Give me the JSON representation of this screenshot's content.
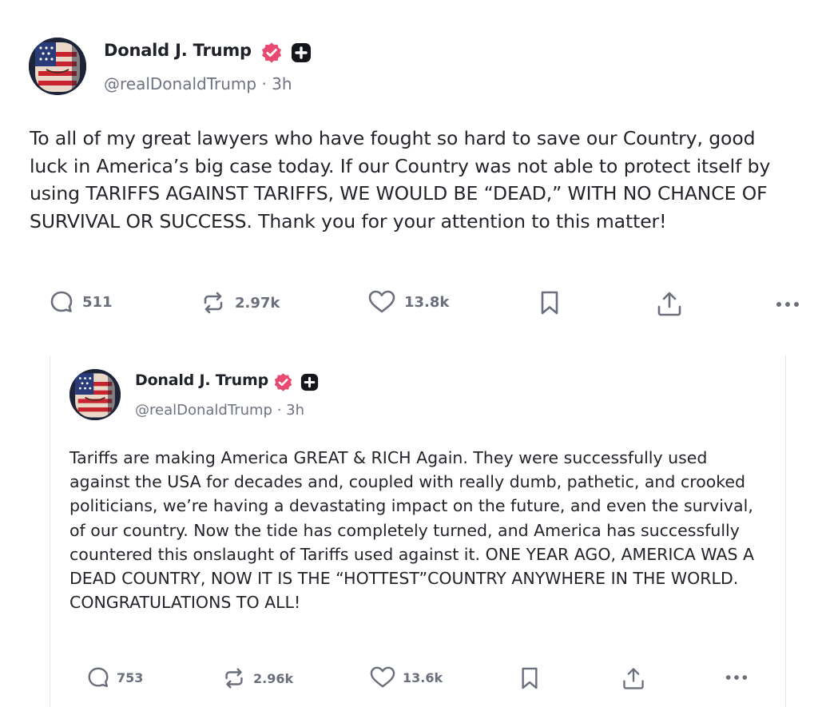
{
  "post": {
    "author": "Donald J. Trump",
    "handle": "@realDonaldTrump",
    "separator": "·",
    "time": "3h",
    "body": "To all of my great lawyers who have fought so hard to save our Country, good luck in America’s big case today. If our Country was not able to protect itself by using TARIFFS AGAINST TARIFFS, WE WOULD BE “DEAD,” WITH NO CHANCE OF SURVIVAL OR SUCCESS. Thank you for your attention to this matter!",
    "replies": "511",
    "reposts": "2.97k",
    "likes": "13.8k"
  },
  "quote": {
    "author": "Donald J. Trump",
    "handle": "@realDonaldTrump",
    "separator": "·",
    "time": "3h",
    "body": "Tariffs are making America GREAT & RICH Again. They were successfully used against the USA for decades and, coupled with really dumb, pathetic, and crooked politicians, we’re having a devastating impact on the future, and even the survival, of our country. Now the tide has completely turned, and America has successfully countered this onslaught of Tariffs used against it. ONE YEAR AGO, AMERICA WAS A DEAD COUNTRY, NOW IT IS THE “HOTTEST”COUNTRY ANYWHERE IN THE WORLD. CONGRATULATIONS TO ALL!",
    "replies": "753",
    "reposts": "2.96k",
    "likes": "13.6k"
  },
  "icons": {
    "verified": "verified-badge-icon",
    "plus": "plus-badge-icon",
    "reply": "reply-icon",
    "repost": "repost-icon",
    "like": "heart-icon",
    "bookmark": "bookmark-icon",
    "share": "share-icon",
    "more": "more-icon"
  },
  "colors": {
    "verified": "#e84a72",
    "text": "#222429",
    "muted": "#6f7382",
    "icon": "#6b6f7c"
  }
}
